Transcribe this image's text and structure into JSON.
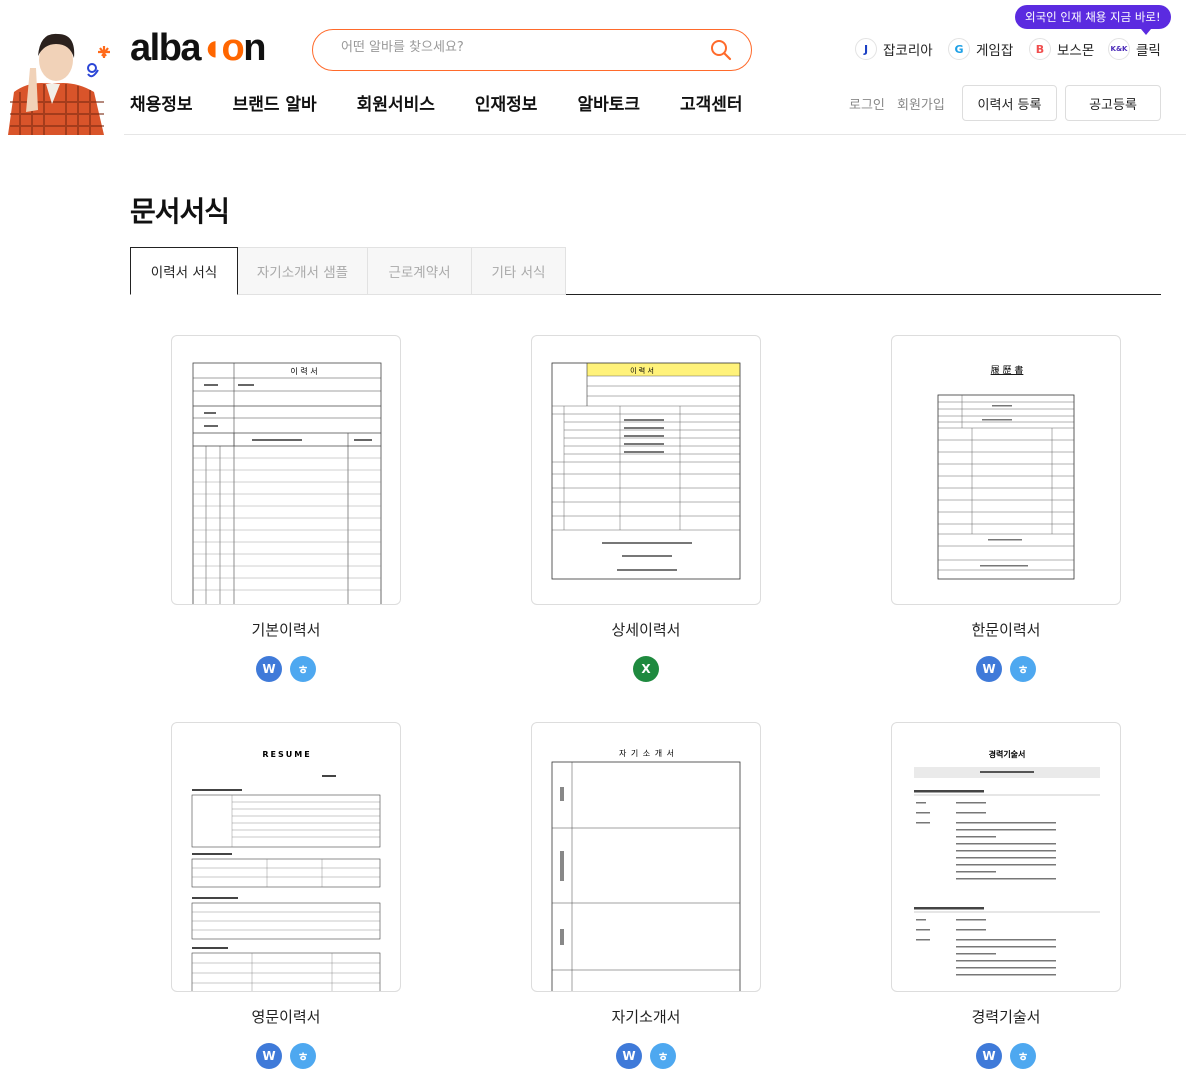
{
  "header": {
    "logo": {
      "pre": "alba",
      "accent": "m",
      "rest": "o",
      "tail": "n"
    },
    "search": {
      "placeholder": "어떤 알바를 찾으세요?"
    },
    "family_sites": [
      {
        "badge": "J",
        "label": "잡코리아",
        "color": "#1a3fc4"
      },
      {
        "badge": "G",
        "label": "게임잡",
        "color": "#1ea0e6"
      },
      {
        "badge": "B",
        "label": "보스몬",
        "color": "#f04e4e"
      },
      {
        "badge": "K&K",
        "label": "클릭",
        "color": "#4b2bb8"
      }
    ],
    "promo": "외국인 인재 채용 지금 바로!",
    "nav": [
      "채용정보",
      "브랜드 알바",
      "회원서비스",
      "인재정보",
      "알바토크",
      "고객센터"
    ],
    "login": "로그인",
    "signup": "회원가입",
    "resume_register": "이력서 등록",
    "job_post": "공고등록"
  },
  "page_title": "문서서식",
  "tabs": [
    "이력서 서식",
    "자기소개서 샘플",
    "근로계약서",
    "기타 서식"
  ],
  "cards": [
    {
      "name": "기본이력서",
      "formats": [
        "W",
        "ㅎ"
      ]
    },
    {
      "name": "상세이력서",
      "formats": [
        "X"
      ]
    },
    {
      "name": "한문이력서",
      "formats": [
        "W",
        "ㅎ"
      ]
    },
    {
      "name": "영문이력서",
      "formats": [
        "W",
        "ㅎ"
      ]
    },
    {
      "name": "자기소개서",
      "formats": [
        "W",
        "ㅎ"
      ]
    },
    {
      "name": "경력기술서",
      "formats": [
        "W",
        "ㅎ"
      ]
    }
  ],
  "thumbs": {
    "basic_title": "이 력 서",
    "detail_title": "이 력 서",
    "hanja_title": "履 歷 書",
    "english_title": "RESUME",
    "intro_title": "자 기 소 개 서",
    "career_title": "경력기술서"
  }
}
